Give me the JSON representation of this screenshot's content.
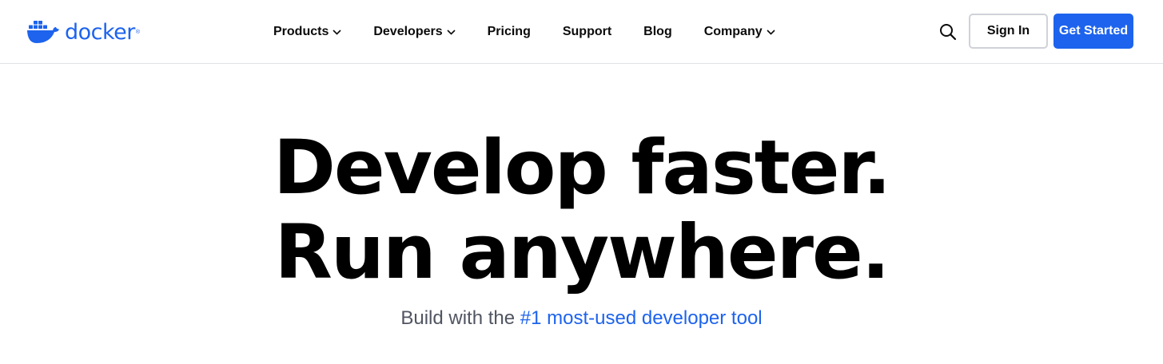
{
  "brand": {
    "logo_text": "docker",
    "registered_mark": "®",
    "logo_icon": "docker-whale-icon",
    "color": "#1d63ed"
  },
  "nav": {
    "items": [
      {
        "label": "Products",
        "has_dropdown": true
      },
      {
        "label": "Developers",
        "has_dropdown": true
      },
      {
        "label": "Pricing",
        "has_dropdown": false
      },
      {
        "label": "Support",
        "has_dropdown": false
      },
      {
        "label": "Blog",
        "has_dropdown": false
      },
      {
        "label": "Company",
        "has_dropdown": true
      }
    ]
  },
  "header_actions": {
    "search_icon": "search-icon",
    "sign_in_label": "Sign In",
    "get_started_label": "Get Started"
  },
  "hero": {
    "title_line1": "Develop faster.",
    "title_line2": "Run anywhere.",
    "subtitle_prefix": "Build with the",
    "subtitle_link": "#1 most-used developer tool"
  },
  "colors": {
    "accent": "#1d63ed",
    "text_dark": "#0b0b0b",
    "subtitle_gray": "#505561",
    "border": "#e1e2e6"
  }
}
